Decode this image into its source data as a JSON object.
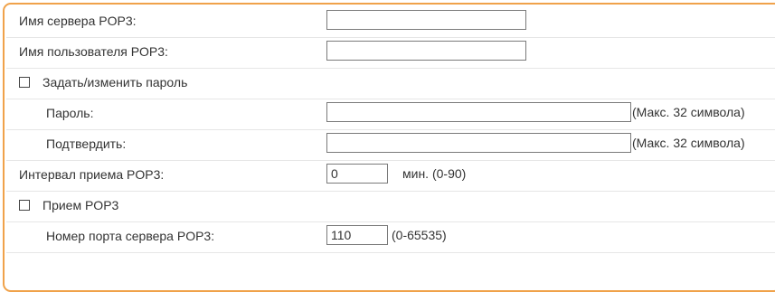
{
  "settings": {
    "pop3_server": {
      "label": "Имя сервера POP3:",
      "value": ""
    },
    "pop3_user": {
      "label": "Имя пользователя POP3:",
      "value": ""
    },
    "set_password": {
      "label": "Задать/изменить пароль",
      "checked": false
    },
    "password": {
      "label": "Пароль:",
      "value": "",
      "hint": "(Макс. 32 символа)"
    },
    "confirm": {
      "label": "Подтвердить:",
      "value": "",
      "hint": "(Макс. 32 символа)"
    },
    "interval": {
      "label": "Интервал приема POP3:",
      "value": "0",
      "hint": "мин. (0-90)"
    },
    "pop3_receive": {
      "label": "Прием POP3",
      "checked": false
    },
    "port": {
      "label": "Номер порта сервера POP3:",
      "value": "110",
      "hint": "(0-65535)"
    }
  },
  "colors": {
    "panel_border": "#f0a24a",
    "row_divider": "#e6e6e6",
    "text": "#333333"
  }
}
